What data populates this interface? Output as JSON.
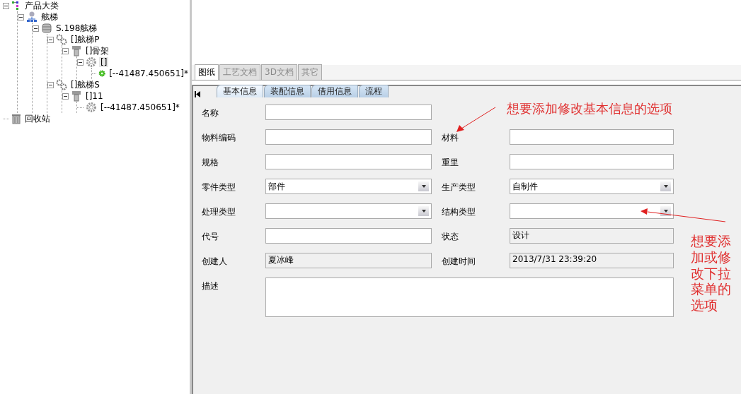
{
  "tree": [
    {
      "label": "产品大类",
      "kind": "category",
      "expanded": true,
      "selected": false,
      "children": [
        {
          "label": "舷梯",
          "kind": "assembly",
          "expanded": true,
          "selected": false,
          "children": [
            {
              "label": "S.198舷梯",
              "kind": "database",
              "expanded": true,
              "selected": false,
              "children": [
                {
                  "label": "[]舷梯P",
                  "kind": "parts",
                  "expanded": true,
                  "selected": false,
                  "children": [
                    {
                      "label": "[]骨架",
                      "kind": "screw",
                      "expanded": true,
                      "selected": false,
                      "children": [
                        {
                          "label": "[]",
                          "kind": "gear",
                          "expanded": true,
                          "selected": true,
                          "children": [
                            {
                              "label": "[--41487.450651]*",
                              "kind": "gear-green",
                              "selected": false
                            }
                          ]
                        }
                      ]
                    }
                  ]
                },
                {
                  "label": "[]舷梯S",
                  "kind": "parts",
                  "expanded": true,
                  "selected": false,
                  "children": [
                    {
                      "label": "[]11",
                      "kind": "screw",
                      "expanded": true,
                      "selected": false,
                      "children": [
                        {
                          "label": "[--41487.450651]*",
                          "kind": "gear",
                          "selected": false
                        }
                      ]
                    }
                  ]
                }
              ]
            }
          ]
        }
      ]
    },
    {
      "label": "回收站",
      "kind": "trash",
      "selected": false
    }
  ],
  "tabs": [
    {
      "label": "图纸",
      "selected": true
    },
    {
      "label": "工艺文档",
      "selected": false
    },
    {
      "label": "3D文档",
      "selected": false
    },
    {
      "label": "其它",
      "selected": false
    }
  ],
  "subtabs": [
    {
      "label": "基本信息",
      "selected": true
    },
    {
      "label": "装配信息",
      "selected": false
    },
    {
      "label": "借用信息",
      "selected": false
    },
    {
      "label": "流程",
      "selected": false
    }
  ],
  "form": [
    {
      "label": "名称",
      "kind": "text"
    },
    {
      "kind": "empty"
    },
    {
      "label": "物料编码",
      "kind": "text"
    },
    {
      "label": "材料",
      "kind": "text"
    },
    {
      "label": "规格",
      "kind": "text"
    },
    {
      "label": "重里",
      "kind": "text"
    },
    {
      "label": "零件类型",
      "kind": "dropdown",
      "value": "部件"
    },
    {
      "label": "生产类型",
      "kind": "dropdown",
      "value": "自制件"
    },
    {
      "label": "处理类型",
      "kind": "dropdown"
    },
    {
      "label": "结构类型",
      "kind": "dropdown"
    },
    {
      "label": "代号",
      "kind": "text"
    },
    {
      "label": "状态",
      "kind": "readonly",
      "value": "设计"
    },
    {
      "label": "创建人",
      "kind": "readonly",
      "value": "夏冰峰"
    },
    {
      "label": "创建时间",
      "kind": "readonly",
      "value": "2013/7/31 23:39:20"
    },
    {
      "label": "描述",
      "kind": "textarea"
    }
  ],
  "annotations": [
    {
      "text": "想要添加修改基本信息的选项",
      "kind": "horizontal"
    },
    {
      "text": "想要添加或修改下拉菜单的选项",
      "kind": "vertical"
    }
  ]
}
